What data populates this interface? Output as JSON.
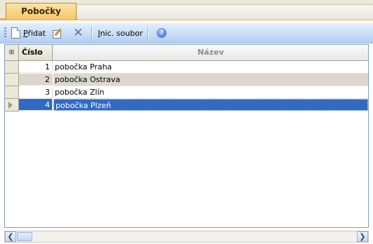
{
  "tabs": [
    {
      "label": "Pobočky",
      "active": true
    }
  ],
  "toolbar": {
    "add_label_ul": "P",
    "add_label_rest": "řidat",
    "init_label_ul": "I",
    "init_label_rest": "nic. soubor",
    "icons": [
      "new-document-icon",
      "edit-icon",
      "delete-icon",
      "help-icon"
    ]
  },
  "grid": {
    "columns": [
      "Číslo",
      "Název"
    ],
    "rows": [
      {
        "cislo": "1",
        "nazev": "pobočka Praha"
      },
      {
        "cislo": "2",
        "nazev": "pobočka Ostrava"
      },
      {
        "cislo": "3",
        "nazev": "pobočka Zlín"
      },
      {
        "cislo": "4",
        "nazev": "pobočka Plzeň"
      }
    ],
    "current_row": 4
  },
  "colors": {
    "selection": "#316ac5",
    "tab_accent": "#f4a55a",
    "alt_row": "#ddd7cb"
  }
}
